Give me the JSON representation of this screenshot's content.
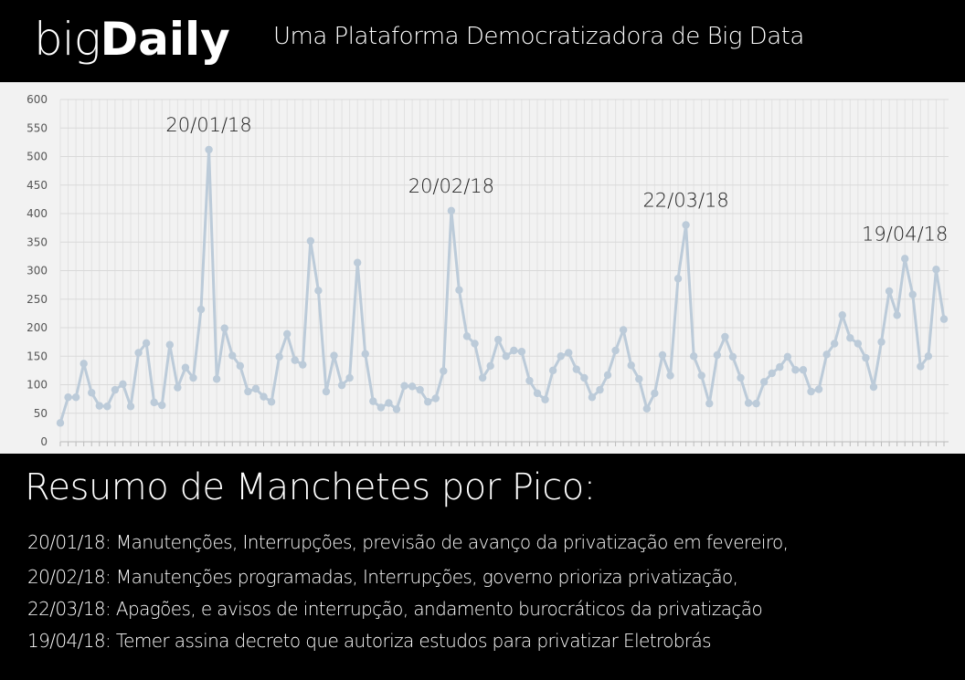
{
  "header": {
    "brand_light": "big",
    "brand_bold": "Daily",
    "tagline": "Uma Plataforma Democratizadora de Big Data"
  },
  "chart_data": {
    "type": "line",
    "ylim": [
      0,
      600
    ],
    "yticks": [
      0,
      50,
      100,
      150,
      200,
      250,
      300,
      350,
      400,
      450,
      500,
      550,
      600
    ],
    "grid": true,
    "line_color": "#bccbd9",
    "point_color": "#bccbd9",
    "series": [
      {
        "values": [
          33,
          78,
          78,
          137,
          86,
          63,
          62,
          91,
          101,
          62,
          156,
          173,
          69,
          64,
          170,
          95,
          130,
          112,
          232,
          512,
          110,
          199,
          151,
          133,
          88,
          93,
          79,
          70,
          149,
          189,
          143,
          135,
          352,
          265,
          88,
          151,
          99,
          112,
          314,
          154,
          71,
          60,
          68,
          57,
          98,
          97,
          91,
          70,
          76,
          124,
          405,
          266,
          185,
          172,
          112,
          133,
          179,
          150,
          160,
          158,
          107,
          85,
          74,
          125,
          150,
          156,
          127,
          112,
          78,
          91,
          117,
          160,
          196,
          134,
          110,
          58,
          85,
          152,
          116,
          286,
          380,
          150,
          116,
          67,
          152,
          184,
          149,
          112,
          68,
          67,
          105,
          120,
          131,
          149,
          126,
          126,
          88,
          92,
          153,
          172,
          222,
          182,
          172,
          147,
          96,
          175,
          264,
          222,
          321,
          258,
          132,
          150,
          302,
          215
        ]
      }
    ],
    "annotations": [
      {
        "label": "20/01/18",
        "index": 19
      },
      {
        "label": "20/02/18",
        "index": 50
      },
      {
        "label": "22/03/18",
        "index": 80
      },
      {
        "label": "19/04/18",
        "index": 108
      }
    ]
  },
  "summary": {
    "title": "Resumo de Manchetes por Pico:",
    "lines": [
      "20/01/18: Manutenções, Interrupções, previsão de avanço da privatização em fevereiro,",
      "20/02/18: Manutenções programadas, Interrupções, governo prioriza privatização,",
      "22/03/18: Apagões, e avisos de interrupção, andamento burocráticos da privatização",
      "19/04/18: Temer assina decreto que autoriza estudos para privatizar Eletrobrás"
    ]
  }
}
